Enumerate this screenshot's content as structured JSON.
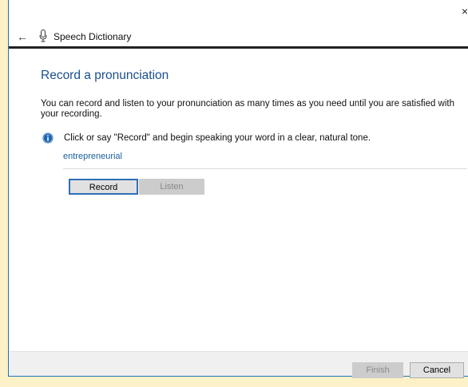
{
  "window": {
    "close_glyph": "×"
  },
  "nav": {
    "back_glyph": "←",
    "title": "Speech Dictionary",
    "icon": "microphone-icon"
  },
  "main": {
    "heading": "Record a pronunciation",
    "description": "You can record and listen to your pronunciation as many times as you need until you are satisfied with your recording.",
    "info_text": "Click or say \"Record\" and begin speaking your word in a clear, natural tone.",
    "info_icon": "info-icon",
    "word": "entrepreneurial",
    "record_label": "Record",
    "listen_label": "Listen"
  },
  "footer": {
    "finish_label": "Finish",
    "cancel_label": "Cancel"
  },
  "colors": {
    "accent": "#1a4f8f",
    "info_blue": "#1e64b4",
    "focus_border": "#2f6fb5",
    "desktop_bg": "#fdf2c7"
  }
}
